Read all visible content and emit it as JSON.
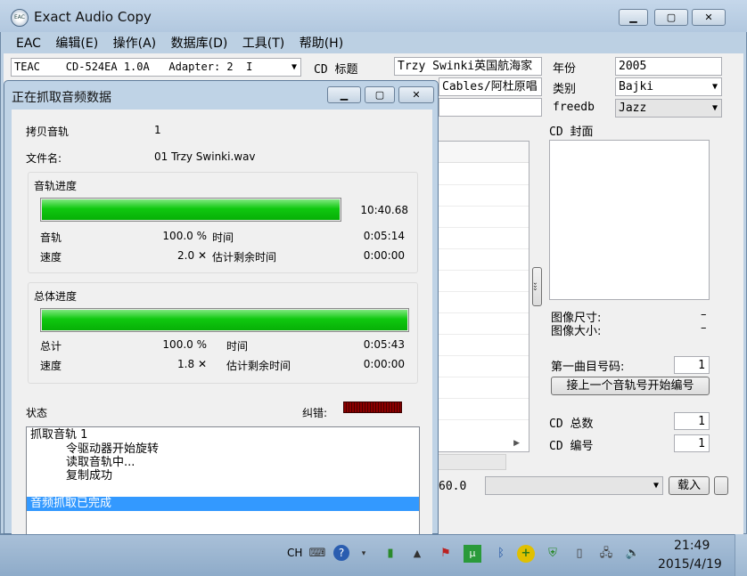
{
  "app": {
    "title": "Exact Audio Copy",
    "icon_text": "EAC",
    "menu": [
      "EAC",
      "编辑(E)",
      "操作(A)",
      "数据库(D)",
      "工具(T)",
      "帮助(H)"
    ]
  },
  "main": {
    "drive": "TEAC    CD-524EA 1.0A   Adapter: 2  I",
    "cd_title_label": "CD 标题",
    "cd_title_value": "Trzy Swinki英国航海家",
    "artist_value": "Cables/阿杜原唱",
    "year_label": "年份",
    "year_value": "2005",
    "genre_label": "类别",
    "genre_value": "Bajki",
    "freedb_label": "freedb",
    "freedb_value": "Jazz",
    "cover_label": "CD 封面",
    "image_size_label": "图像尺寸:",
    "image_size_value": "–",
    "image_bytes_label": "图像大小:",
    "image_bytes_value": "–",
    "first_track_label": "第一曲目号码:",
    "first_track_value": "1",
    "continue_numbering": "接上一个音轨号开始编号",
    "cd_total_label": "CD 总数",
    "cd_total_value": "1",
    "cd_number_label": "CD 编号",
    "cd_number_value": "1",
    "time_fragment": "60.0",
    "load_button": "载入",
    "expand_arrows": "›››"
  },
  "dialog": {
    "title": "正在抓取音频数据",
    "copy_track_label": "拷贝音轨",
    "copy_track_value": "1",
    "filename_label": "文件名:",
    "filename_value": "01 Trzy Swinki.wav",
    "track_group": "音轨进度",
    "track_progress": 100,
    "track_elapsed": "10:40.68",
    "track_label": "音轨",
    "track_pct": "100.0 %",
    "track_time_label": "时间",
    "track_time_value": "0:05:14",
    "track_speed_label": "速度",
    "track_speed_value": "2.0 ✕",
    "track_remaining_label": "估计剩余时间",
    "track_remaining_value": "0:00:00",
    "total_group": "总体进度",
    "total_progress": 100,
    "total_label": "总计",
    "total_pct": "100.0 %",
    "total_time_label": "时间",
    "total_time_value": "0:05:43",
    "total_speed_label": "速度",
    "total_speed_value": "1.8 ✕",
    "total_remaining_label": "估计剩余时间",
    "total_remaining_value": "0:00:00",
    "status_label": "状态",
    "error_label": "纠错:",
    "log": [
      "抓取音轨  1",
      "令驱动器开始旋转",
      "读取音轨中...",
      "复制成功"
    ],
    "log_done": "音频抓取已完成"
  },
  "taskbar": {
    "lang": "CH",
    "time": "21:49",
    "date": "2015/4/19"
  },
  "colors": {
    "progress": "#10c810",
    "error_meter": "#8b0000",
    "selection": "#3399ff"
  }
}
